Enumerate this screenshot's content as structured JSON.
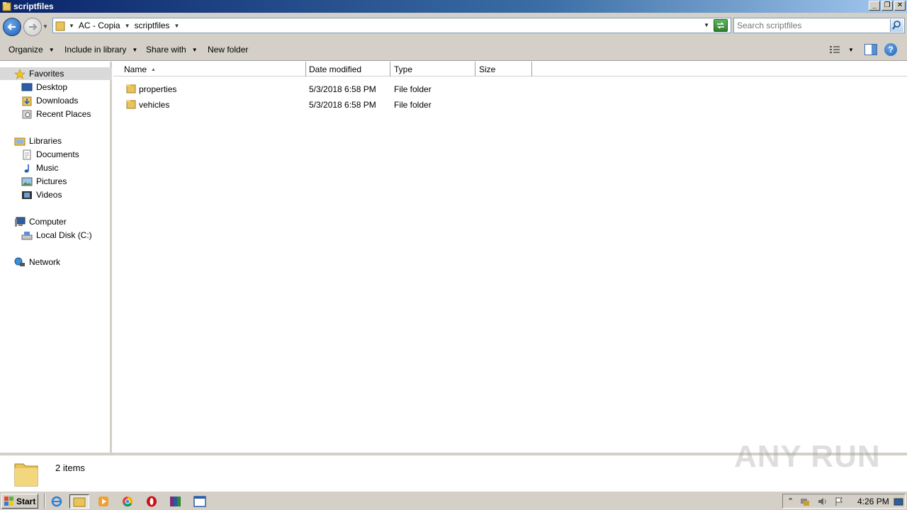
{
  "window": {
    "title": "scriptfiles"
  },
  "address": {
    "crumbs": [
      "AC - Copia",
      "scriptfiles"
    ],
    "search_placeholder": "Search scriptfiles"
  },
  "toolbar": {
    "organize": "Organize",
    "include_in_library": "Include in library",
    "share_with": "Share with",
    "new_folder": "New folder"
  },
  "nav": {
    "favorites": "Favorites",
    "desktop": "Desktop",
    "downloads": "Downloads",
    "recent_places": "Recent Places",
    "libraries": "Libraries",
    "documents": "Documents",
    "music": "Music",
    "pictures": "Pictures",
    "videos": "Videos",
    "computer": "Computer",
    "local_disk": "Local Disk (C:)",
    "network": "Network"
  },
  "columns": {
    "name": "Name",
    "date_modified": "Date modified",
    "type": "Type",
    "size": "Size"
  },
  "files": [
    {
      "name": "properties",
      "date": "5/3/2018 6:58 PM",
      "type": "File folder",
      "size": ""
    },
    {
      "name": "vehicles",
      "date": "5/3/2018 6:58 PM",
      "type": "File folder",
      "size": ""
    }
  ],
  "details": {
    "count": "2 items"
  },
  "watermark": "ANY RUN",
  "taskbar": {
    "start": "Start",
    "clock": "4:26 PM"
  },
  "colors": {
    "title_bar": "#0a246a",
    "chrome": "#d4d0c8",
    "folder": "#e8c45c"
  }
}
